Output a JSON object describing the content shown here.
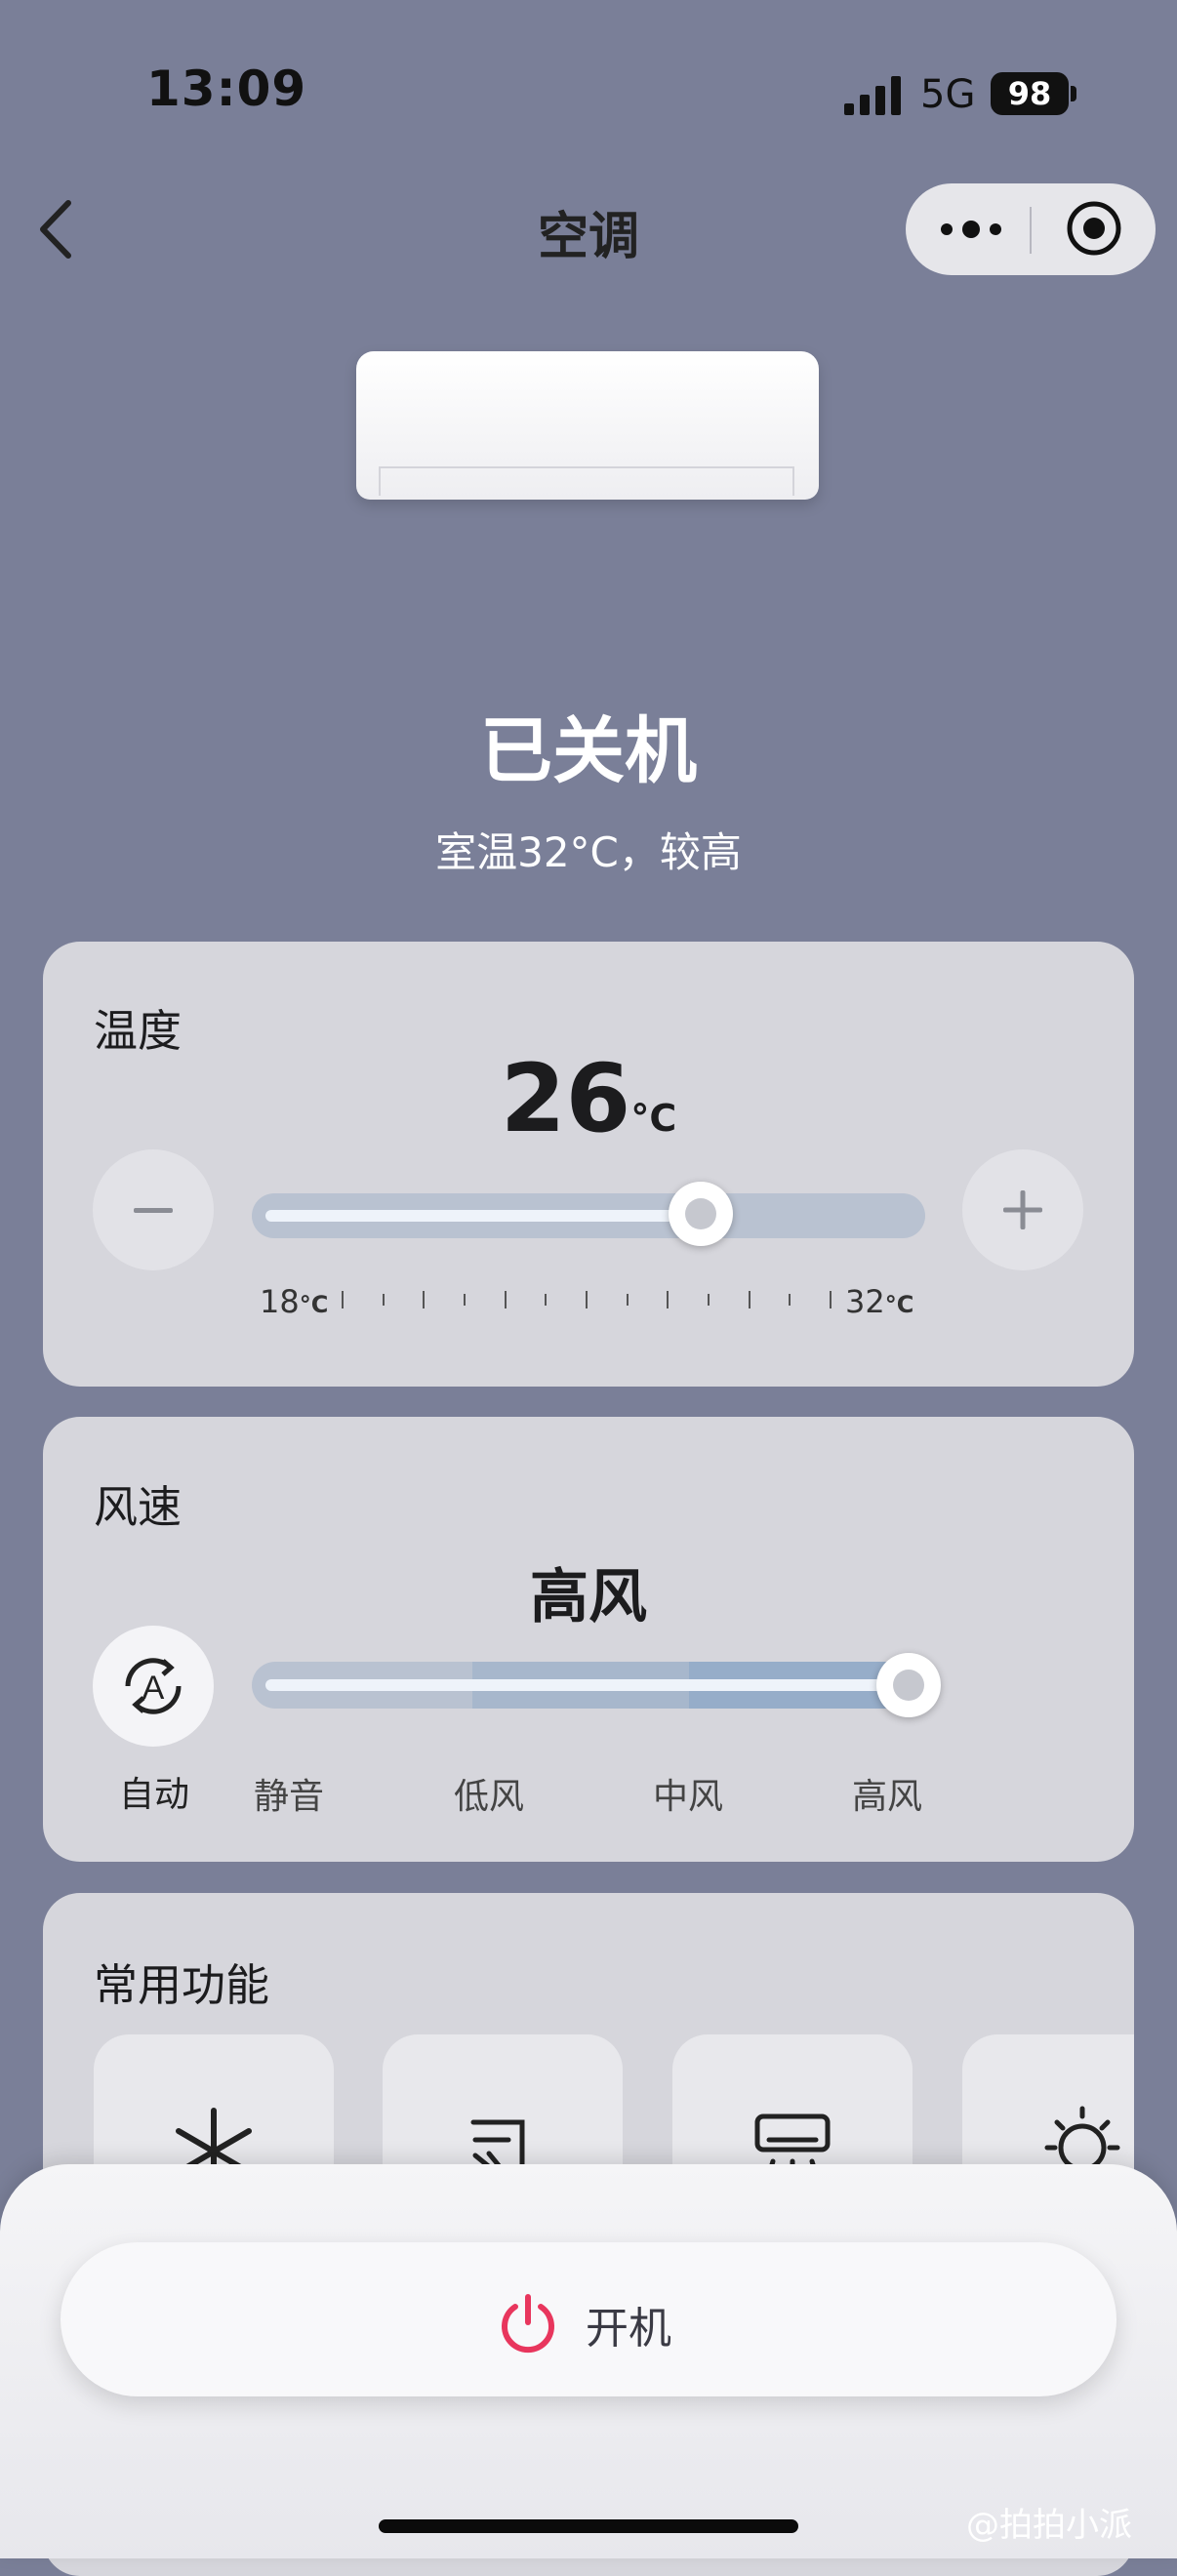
{
  "status_bar": {
    "time": "13:09",
    "network": "5G",
    "battery": "98"
  },
  "nav": {
    "title": "空调"
  },
  "device": {
    "state": "已关机",
    "room_temp_text": "室温32°C，较高"
  },
  "temperature": {
    "title": "温度",
    "value": "26",
    "unit": "°C",
    "min_label": "18",
    "max_label": "32",
    "unit_small": "°C",
    "min": 18,
    "max": 32,
    "current": 26
  },
  "fan": {
    "title": "风速",
    "value": "高风",
    "auto_label": "自动",
    "levels": [
      "静音",
      "低风",
      "中风",
      "高风"
    ],
    "current_index": 3
  },
  "functions": {
    "title": "常用功能",
    "icons": [
      "snowflake-icon",
      "sun-wind-icon",
      "ac-airflow-icon",
      "lightbulb-icon"
    ]
  },
  "power": {
    "label": "开机",
    "icon_color": "#e8365d"
  },
  "watermark": "@拍拍小派",
  "colors": {
    "background": "#7a7f98",
    "card": "#d6d6dc",
    "track": "#b9c2d1",
    "accent": "#e8365d"
  }
}
